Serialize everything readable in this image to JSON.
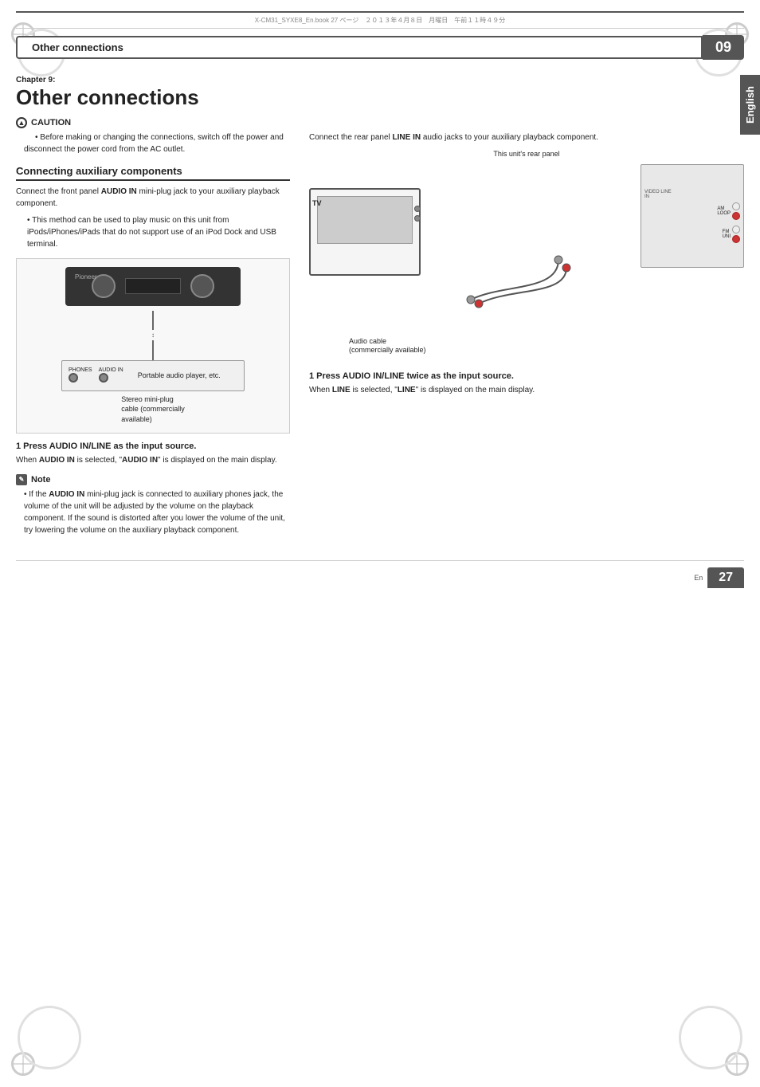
{
  "header": {
    "chapter_header_text": "Other connections",
    "chapter_number": "09",
    "file_info": "X-CM31_SYXE8_En.book  27 ページ　２０１３年４月８日　月曜日　午前１１時４９分"
  },
  "english_tab": "English",
  "chapter": {
    "label": "Chapter 9:",
    "title": "Other connections"
  },
  "caution": {
    "header": "CAUTION",
    "bullet": "Before making or changing the connections, switch off the power and disconnect the power cord from the AC outlet."
  },
  "connecting_aux": {
    "heading": "Connecting auxiliary components",
    "intro": "Connect the front panel AUDIO IN mini-plug jack to your auxiliary playback component.",
    "bullet": "This method can be used to play music on this unit from iPods/iPhones/iPads that do not support use of an iPod Dock and USB terminal.",
    "diagram_caption_1": "Stereo mini-plug\ncable (commercially\navailable)",
    "diagram_caption_2": "Portable audio player, etc."
  },
  "step1_left": {
    "heading": "1    Press AUDIO IN/LINE as the input source.",
    "text": "When AUDIO IN is selected, \"AUDIO IN\" is displayed on the main display."
  },
  "note": {
    "header": "Note",
    "bullet": "If the AUDIO IN mini-plug jack is connected to auxiliary phones jack, the volume of the unit will be adjusted by the volume on the playback component. If the sound is distorted after you lower the volume of the unit, try lowering the volume on the auxiliary playback component."
  },
  "right_col": {
    "intro": "Connect the rear panel LINE IN audio jacks to your auxiliary playback component.",
    "rear_panel_label": "This unit's rear panel",
    "tv_label": "TV",
    "audio_cable_label": "Audio cable\n(commercially available)"
  },
  "step1_right": {
    "heading": "1    Press AUDIO IN/LINE twice as the input source.",
    "text": "When LINE is selected, \"LINE\" is displayed on the main display."
  },
  "footer": {
    "page_number": "27",
    "page_en": "En"
  }
}
